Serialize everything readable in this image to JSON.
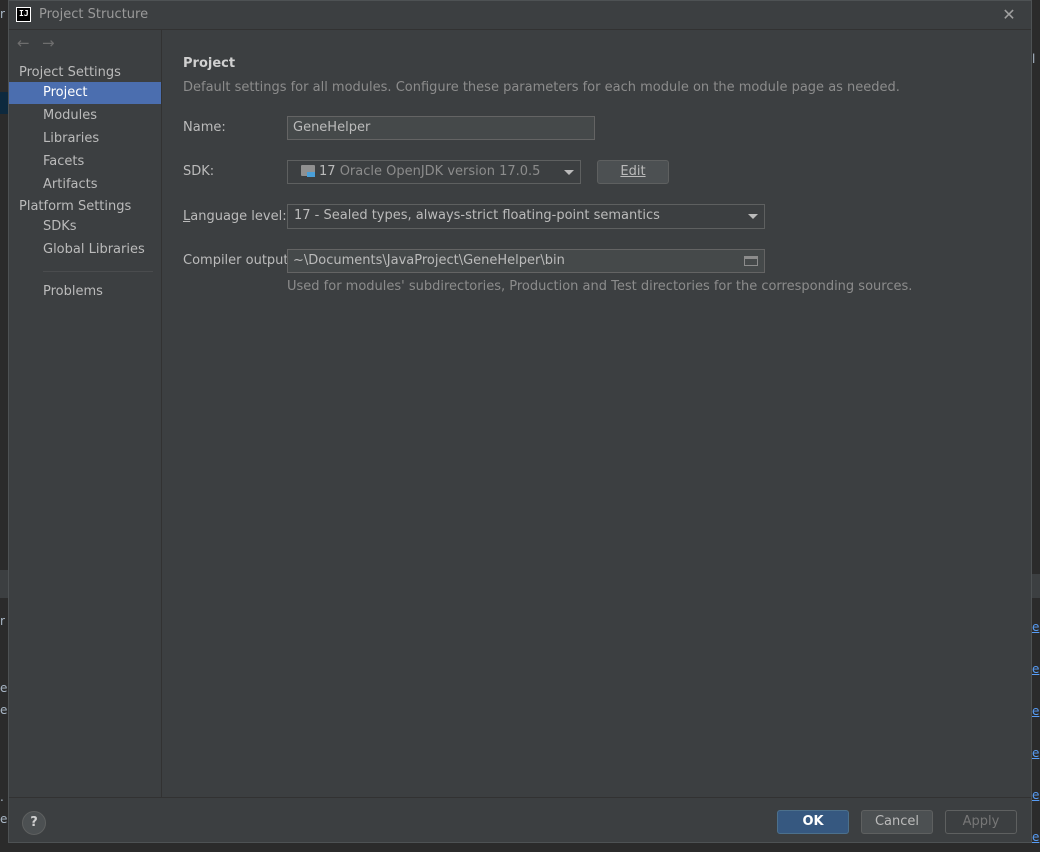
{
  "window": {
    "title": "Project Structure",
    "app_icon_text": "IJ"
  },
  "nav": {
    "back_icon": "←",
    "forward_icon": "→"
  },
  "sidebar": {
    "project_settings_header": "Project Settings",
    "project_settings_items": [
      "Project",
      "Modules",
      "Libraries",
      "Facets",
      "Artifacts"
    ],
    "platform_settings_header": "Platform Settings",
    "platform_settings_items": [
      "SDKs",
      "Global Libraries"
    ],
    "problems_label": "Problems",
    "selected_item": "Project"
  },
  "main": {
    "title": "Project",
    "description": "Default settings for all modules. Configure these parameters for each module on the module page as needed.",
    "name_label": "Name:",
    "name_value": "GeneHelper",
    "sdk_label": "SDK:",
    "sdk_version": "17",
    "sdk_name": "Oracle OpenJDK version 17.0.5",
    "edit_button": "Edit",
    "language_level_label_first": "L",
    "language_level_label_rest": "anguage level:",
    "language_level_value": "17 - Sealed types, always-strict floating-point semantics",
    "compiler_output_label": "Compiler output:",
    "compiler_output_value": "~\\Documents\\JavaProject\\GeneHelper\\bin",
    "compiler_output_hint": "Used for modules' subdirectories, Production and Test directories for the corresponding sources."
  },
  "footer": {
    "help_label": "?",
    "ok_button": "OK",
    "cancel_button": "Cancel",
    "apply_button": "Apply"
  },
  "background": {
    "left_chars": [
      "r",
      "r",
      "e",
      "e",
      ".",
      "e"
    ],
    "right_chars": [
      "l"
    ],
    "right_links": [
      "e",
      "e",
      "e",
      "e",
      "e",
      "e",
      "e"
    ]
  },
  "colors": {
    "dialog_bg": "#3c3f41",
    "selection": "#4b6eaf",
    "default_button": "#365880",
    "link": "#589df6"
  }
}
